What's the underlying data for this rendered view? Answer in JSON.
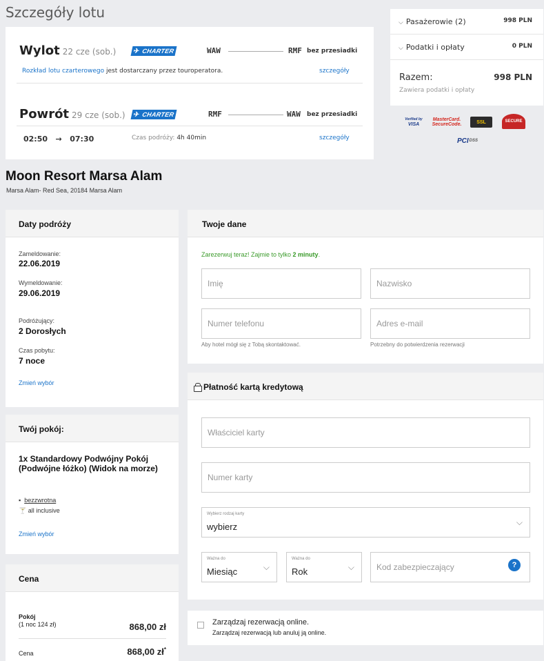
{
  "flight": {
    "section_title": "Szczegóły lotu",
    "charter_label": "CHARTER",
    "direct_label": "bez przesiadki",
    "outbound": {
      "label": "Wylot",
      "date": "22 cze (sob.)",
      "from": "WAW",
      "to": "RMF"
    },
    "note_link": "Rozkład lotu czarterowego",
    "note_rest": " jest dostarczany przez touroperatora.",
    "details_label": "szczegóły",
    "return": {
      "label": "Powrót",
      "date": "29 cze (sob.)",
      "from": "RMF",
      "to": "WAW",
      "dep": "02:50",
      "arrow": "→",
      "arr": "07:30",
      "duration_label": "Czas podróży:",
      "duration": "4h 40min"
    }
  },
  "summary": {
    "passengers_label": "Pasażerowie (2)",
    "passengers_value": "998 PLN",
    "fees_label": "Podatki i opłaty",
    "fees_value": "0 PLN",
    "total_label": "Razem:",
    "total_value": "998 PLN",
    "total_note": "Zawiera podatki i opłaty"
  },
  "badges": {
    "visa_1": "Verified by",
    "visa_2": "VISA",
    "mc_1": "MasterCard.",
    "mc_2": "SecureCode.",
    "ssl": "SSL",
    "secure": "SECURE",
    "pci": "PCI",
    "dss": "DSS"
  },
  "hotel": {
    "name": "Moon Resort Marsa Alam",
    "address": "Marsa Alam- Red Sea, 20184 Marsa Alam"
  },
  "dates": {
    "title": "Daty podróży",
    "checkin_label": "Zameldowanie:",
    "checkin": "22.06.2019",
    "checkout_label": "Wymeldowanie:",
    "checkout": "29.06.2019",
    "travellers_label": "Podróżujący:",
    "travellers": "2 Dorosłych",
    "stay_label": "Czas pobytu:",
    "stay": "7 noce",
    "change_label": "Zmień wybór"
  },
  "room": {
    "title": "Twój pokój:",
    "name": "1x Standardowy Podwójny Pokój (Podwójne łóżko) (Widok na morze)",
    "option_1": "bezzwrotna",
    "option_2": "all inclusive",
    "change_label": "Zmień wybór"
  },
  "price": {
    "title": "Cena",
    "room_label": "Pokój",
    "room_sub": "(1 noc 124 zł)",
    "room_value": "868,00 zł",
    "total_label": "Cena",
    "total_value": "868,00 zł",
    "asterisk": "*"
  },
  "personal": {
    "title": "Twoje dane",
    "promo_text": "Zarezerwuj teraz! Zajmie to tylko ",
    "promo_bold": "2 minuty",
    "promo_end": ".",
    "first_name_placeholder": "Imię",
    "last_name_placeholder": "Nazwisko",
    "phone_placeholder": "Numer telefonu",
    "email_placeholder": "Adres e-mail",
    "phone_hint": "Aby hotel mógł się z Tobą skontaktować.",
    "email_hint": "Potrzebny do potwierdzenia rezerwacji"
  },
  "payment": {
    "title": "Płatność kartą kredytową",
    "holder_placeholder": "Właściciel karty",
    "number_placeholder": "Numer karty",
    "type_caption": "Wybierz rodzaj karty",
    "type_value": "wybierz",
    "month_caption": "Ważna do",
    "month_value": "Miesiąc",
    "year_caption": "Ważna do",
    "year_value": "Rok",
    "cvv_placeholder": "Kod zabezpieczający",
    "help_symbol": "?"
  },
  "manage": {
    "title": "Zarządzaj rezerwacją online.",
    "subtitle": "Zarządzaj rezerwacją lub anuluj ją online."
  },
  "colors": {
    "accent": "#1a73c9",
    "promo": "#3a9a2a",
    "background": "#ebecef"
  }
}
